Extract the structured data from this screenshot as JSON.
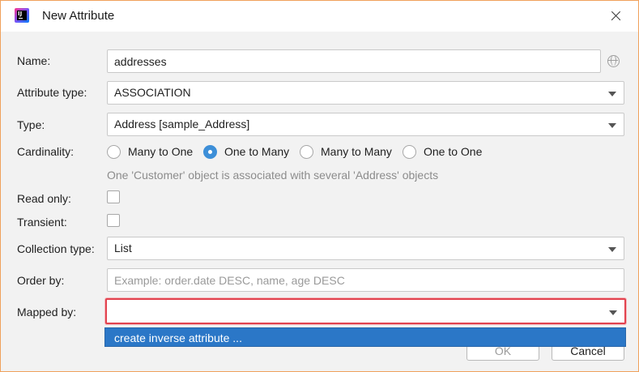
{
  "window": {
    "title": "New Attribute"
  },
  "form": {
    "name": {
      "label": "Name:",
      "value": "addresses"
    },
    "attribute_type": {
      "label": "Attribute type:",
      "value": "ASSOCIATION"
    },
    "type": {
      "label": "Type:",
      "value": "Address [sample_Address]"
    },
    "cardinality": {
      "label": "Cardinality:",
      "options": [
        "Many to One",
        "One to Many",
        "Many to Many",
        "One to One"
      ],
      "selected": "One to Many",
      "hint": "One 'Customer' object is associated with several 'Address' objects"
    },
    "read_only": {
      "label": "Read only:",
      "checked": false
    },
    "transient": {
      "label": "Transient:",
      "checked": false
    },
    "collection_type": {
      "label": "Collection type:",
      "value": "List"
    },
    "order_by": {
      "label": "Order by:",
      "value": "",
      "placeholder": "Example: order.date DESC, name, age DESC"
    },
    "mapped_by": {
      "label": "Mapped by:",
      "value": ""
    }
  },
  "popup": {
    "items": [
      "create inverse attribute ..."
    ]
  },
  "buttons": {
    "ok": "OK",
    "cancel": "Cancel"
  },
  "colors": {
    "accent": "#2b77c7",
    "focus_ring": "#e2434f",
    "radio_on": "#3d8fd8"
  }
}
